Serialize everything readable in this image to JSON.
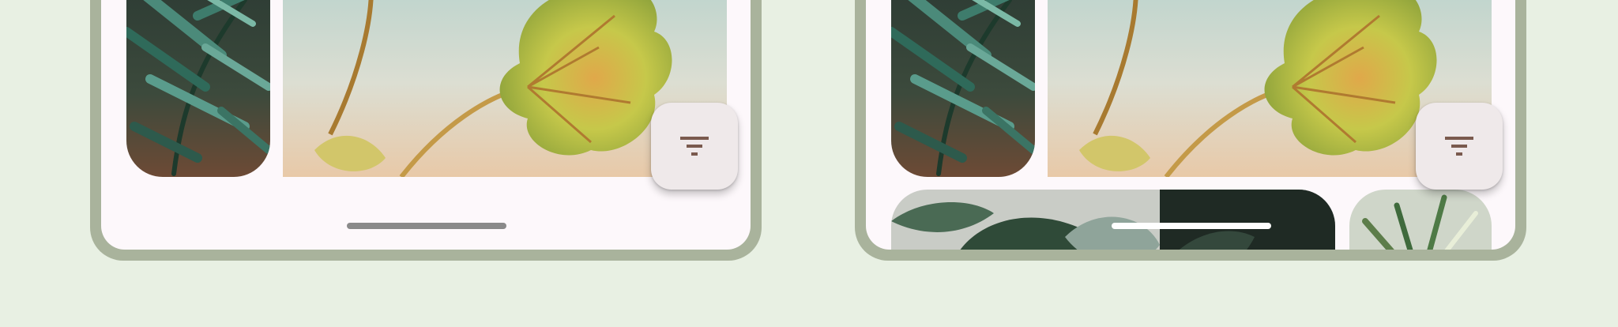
{
  "devices": [
    {
      "id": "left",
      "layout": "single-row"
    },
    {
      "id": "right",
      "layout": "two-rows"
    }
  ],
  "fab": {
    "icon": "filter-list-icon",
    "color": "#7a5a4e"
  },
  "colors": {
    "background": "#e8f0e3",
    "device_frame": "#a9b39c",
    "screen": "#fdf8fb",
    "fab_container": "#efe9ea"
  },
  "gallery": {
    "photos": [
      "parlor-palm-photo",
      "philodendron-leaf-photo",
      "dark-leaf-plant-photo",
      "spider-plant-photo"
    ]
  }
}
